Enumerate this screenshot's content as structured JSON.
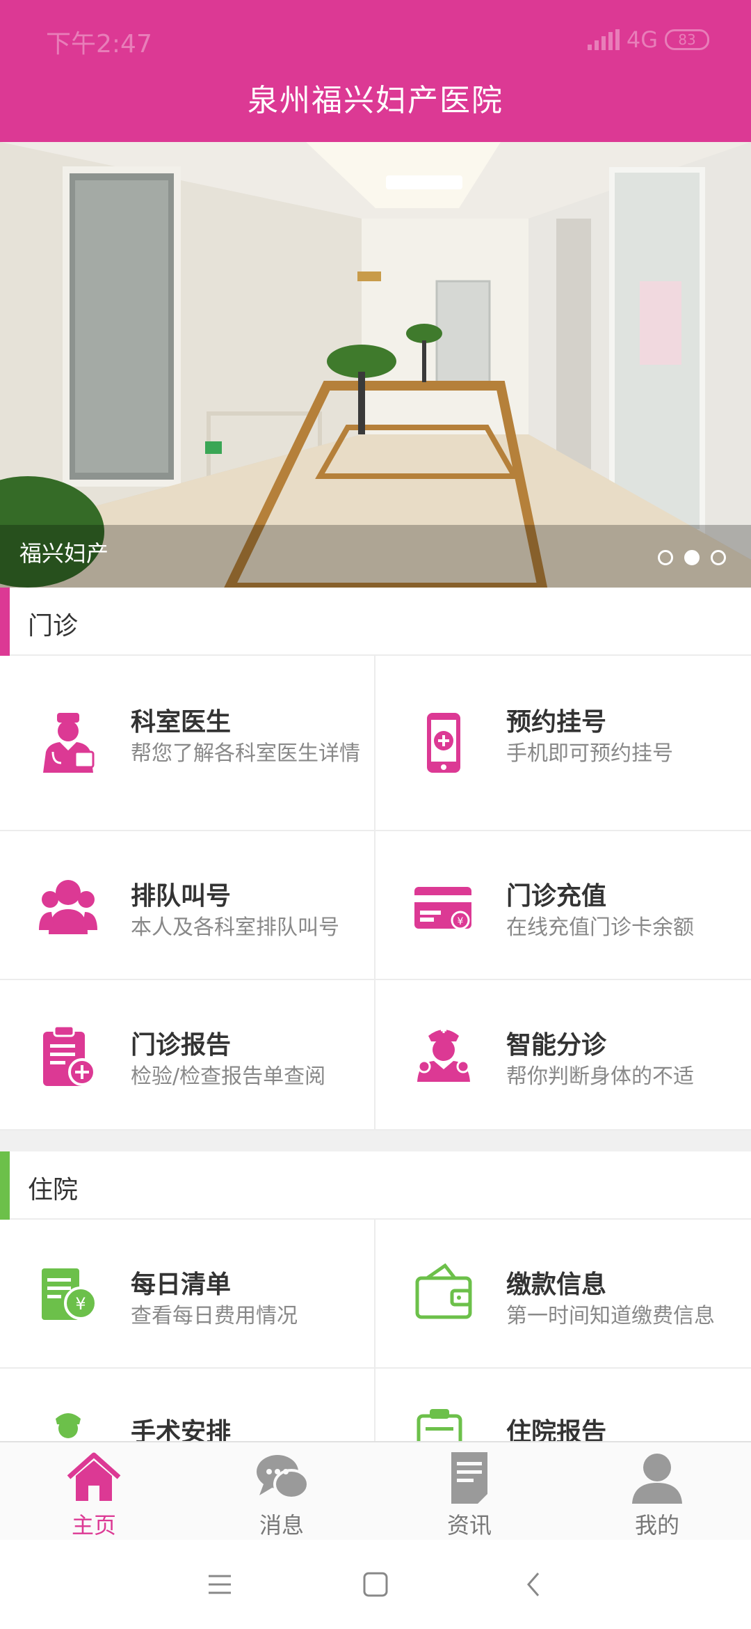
{
  "status": {
    "time": "下午2:47",
    "network": "4G",
    "battery": "83"
  },
  "app_title": "泉州福兴妇产医院",
  "banner": {
    "caption": "福兴妇产",
    "slides": 3,
    "active_slide": 2
  },
  "sections": {
    "outpatient": {
      "title": "门诊",
      "accent": "#dc3994",
      "items": [
        {
          "name": "科室医生",
          "desc": "帮您了解各科室医生详情",
          "icon": "doctor-icon"
        },
        {
          "name": "预约挂号",
          "desc": "手机即可预约挂号",
          "icon": "phone-appointment-icon"
        },
        {
          "name": "排队叫号",
          "desc": "本人及各科室排队叫号",
          "icon": "queue-people-icon"
        },
        {
          "name": "门诊充值",
          "desc": "在线充值门诊卡余额",
          "icon": "card-recharge-icon"
        },
        {
          "name": "门诊报告",
          "desc": "检验/检查报告单查阅",
          "icon": "report-clipboard-icon"
        },
        {
          "name": "智能分诊",
          "desc": "帮你判断身体的不适",
          "icon": "triage-nurse-icon"
        }
      ]
    },
    "inpatient": {
      "title": "住院",
      "accent": "#6cc04a",
      "items": [
        {
          "name": "每日清单",
          "desc": "查看每日费用情况",
          "icon": "daily-bill-icon"
        },
        {
          "name": "缴款信息",
          "desc": "第一时间知道缴费信息",
          "icon": "wallet-icon"
        },
        {
          "name": "手术安排",
          "desc": "",
          "icon": "surgeon-icon"
        },
        {
          "name": "住院报告",
          "desc": "",
          "icon": "inpatient-report-icon"
        }
      ]
    }
  },
  "tabs": [
    {
      "label": "主页",
      "icon": "home-icon",
      "active": true
    },
    {
      "label": "消息",
      "icon": "chat-bubbles-icon",
      "active": false
    },
    {
      "label": "资讯",
      "icon": "news-document-icon",
      "active": false
    },
    {
      "label": "我的",
      "icon": "user-profile-icon",
      "active": false
    }
  ],
  "colors": {
    "brand": "#dc3994",
    "inpatient_accent": "#6cc04a",
    "tab_inactive": "#9a9a9a"
  }
}
